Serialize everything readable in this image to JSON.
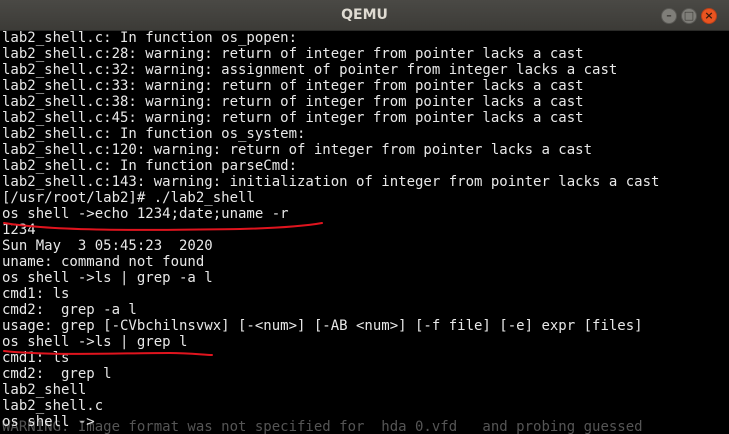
{
  "window": {
    "title": "QEMU",
    "controls": {
      "minimize": "–",
      "maximize": "□",
      "close": "×"
    }
  },
  "terminal": {
    "lines": [
      "lab2_shell.c: In function os_popen:",
      "lab2_shell.c:28: warning: return of integer from pointer lacks a cast",
      "lab2_shell.c:32: warning: assignment of pointer from integer lacks a cast",
      "lab2_shell.c:33: warning: return of integer from pointer lacks a cast",
      "lab2_shell.c:38: warning: return of integer from pointer lacks a cast",
      "lab2_shell.c:45: warning: return of integer from pointer lacks a cast",
      "lab2_shell.c: In function os_system:",
      "lab2_shell.c:120: warning: return of integer from pointer lacks a cast",
      "lab2_shell.c: In function parseCmd:",
      "lab2_shell.c:143: warning: initialization of integer from pointer lacks a cast",
      "[/usr/root/lab2]# ./lab2_shell",
      "os shell ->echo 1234;date;uname -r",
      "1234",
      "Sun May  3 05:45:23  2020",
      "uname: command not found",
      "os shell ->ls | grep -a l",
      "cmd1: ls",
      "cmd2:  grep -a l",
      "usage: grep [-CVbchilnsvwx] [-<num>] [-AB <num>] [-f file] [-e] expr [files]",
      "os shell ->ls | grep l",
      "cmd1: ls",
      "cmd2:  grep l",
      "lab2_shell",
      "lab2_shell.c",
      "os shell ->"
    ],
    "ghost_text": "WARNING: Image format was not specified for  hda 0.vfd   and probing guessed",
    "annotation_color": "#e0141e"
  }
}
